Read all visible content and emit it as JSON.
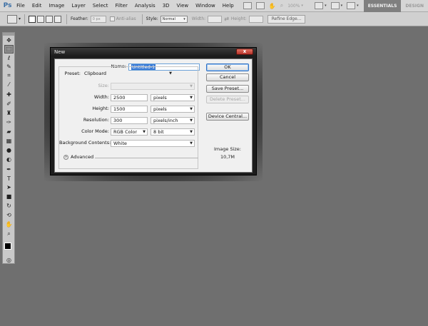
{
  "app": {
    "logo": "Ps"
  },
  "menu": [
    "File",
    "Edit",
    "Image",
    "Layer",
    "Select",
    "Filter",
    "Analysis",
    "3D",
    "View",
    "Window",
    "Help"
  ],
  "menubar_right": {
    "zoom": "100%",
    "essentials": "ESSENTIALS",
    "design": "DESIGN"
  },
  "options": {
    "feather_label": "Feather:",
    "feather_value": "0 px",
    "anti_alias": "Anti-alias",
    "style_label": "Style:",
    "style_value": "Normal",
    "width_label": "Width:",
    "height_label": "Height:",
    "refine_edge": "Refine Edge..."
  },
  "dialog": {
    "title": "New",
    "close": "x",
    "name_label": "Name:",
    "name_value": "Untitled-1",
    "preset_label": "Preset:",
    "preset_value": "Clipboard",
    "size_label": "Size:",
    "width_label": "Width:",
    "width_value": "2500",
    "width_unit": "pixels",
    "height_label": "Height:",
    "height_value": "1500",
    "height_unit": "pixels",
    "resolution_label": "Resolution:",
    "resolution_value": "300",
    "resolution_unit": "pixels/inch",
    "color_mode_label": "Color Mode:",
    "color_mode_value": "RGB Color",
    "bit_depth_value": "8 bit",
    "background_label": "Background Contents:",
    "background_value": "White",
    "advanced_label": "Advanced",
    "buttons": {
      "ok": "OK",
      "cancel": "Cancel",
      "save_preset": "Save Preset...",
      "delete_preset": "Delete Preset...",
      "device_central": "Device Central..."
    },
    "image_size_label": "Image Size:",
    "image_size_value": "10,7M"
  },
  "colors": {
    "accent": "#3a7bd5",
    "close": "#c9463a",
    "workspace": "#6f6f6f"
  },
  "icons": {
    "tools": [
      "move-icon",
      "marquee-icon",
      "lasso-icon",
      "quick-select-icon",
      "crop-icon",
      "eyedropper-icon",
      "healing-brush-icon",
      "brush-icon",
      "clone-stamp-icon",
      "history-brush-icon",
      "eraser-icon",
      "gradient-icon",
      "blur-icon",
      "dodge-icon",
      "pen-icon",
      "type-icon",
      "path-select-icon",
      "shape-icon",
      "3d-rotate-icon",
      "3d-orbit-icon",
      "hand-icon",
      "zoom-icon"
    ]
  }
}
